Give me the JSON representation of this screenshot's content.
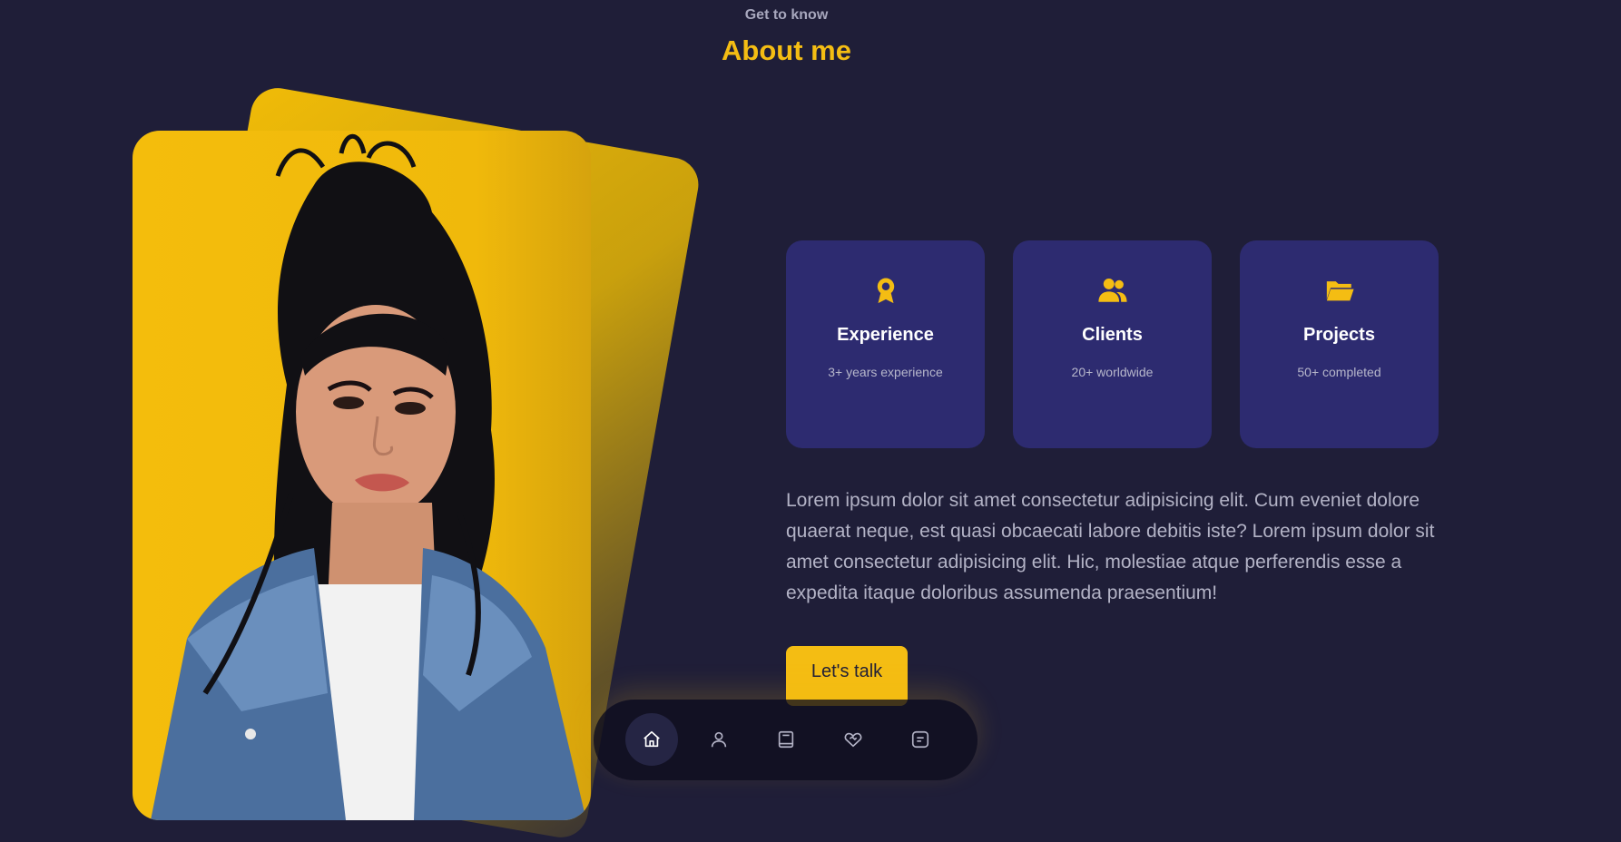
{
  "section": {
    "kicker": "Get to know",
    "title": "About me"
  },
  "stats": [
    {
      "icon": "award-icon",
      "title": "Experience",
      "subtitle": "3+ years experience"
    },
    {
      "icon": "users-icon",
      "title": "Clients",
      "subtitle": "20+ worldwide"
    },
    {
      "icon": "folder-icon",
      "title": "Projects",
      "subtitle": "50+ completed"
    }
  ],
  "about_text": "Lorem ipsum dolor sit amet consectetur adipisicing elit. Cum eveniet dolore quaerat neque, est quasi obcaecati labore debitis iste? Lorem ipsum dolor sit amet consectetur adipisicing elit. Hic, molestiae atque perferendis esse a expedita itaque doloribus assumenda praesentium!",
  "cta": {
    "label": "Let's talk"
  },
  "nav": {
    "items": [
      {
        "icon": "home-icon",
        "active": true
      },
      {
        "icon": "user-icon",
        "active": false
      },
      {
        "icon": "book-icon",
        "active": false
      },
      {
        "icon": "services-icon",
        "active": false
      },
      {
        "icon": "message-icon",
        "active": false
      }
    ]
  },
  "colors": {
    "background": "#1f1e38",
    "accent": "#f4bd13",
    "card": "#2d2b70",
    "text_muted": "#b3b3c6"
  }
}
